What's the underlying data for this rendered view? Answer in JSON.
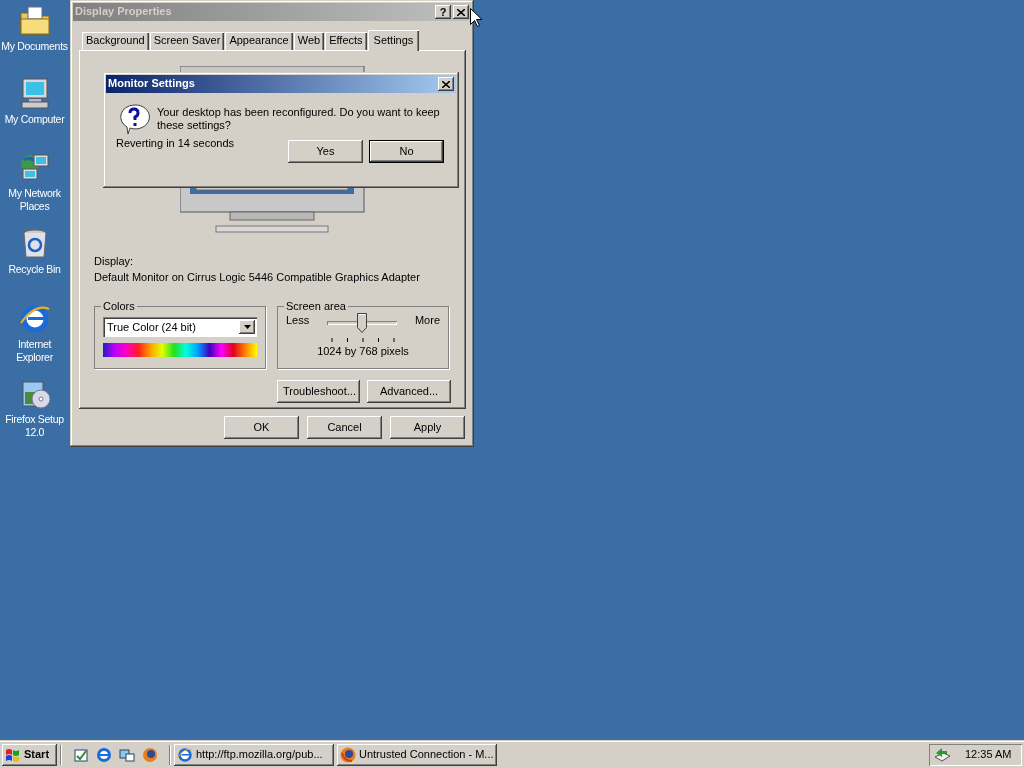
{
  "desktop_icons": [
    {
      "label": "My Documents",
      "kind": "folder"
    },
    {
      "label": "My Computer",
      "kind": "computer"
    },
    {
      "label": "My Network Places",
      "kind": "network"
    },
    {
      "label": "Recycle Bin",
      "kind": "bin"
    },
    {
      "label": "Internet Explorer",
      "kind": "browser"
    },
    {
      "label": "Firefox Setup 12.0",
      "kind": "installer"
    }
  ],
  "display_properties": {
    "title": "Display Properties",
    "active": false,
    "help_button": "?",
    "tabs": [
      {
        "label": "Background",
        "selected": false
      },
      {
        "label": "Screen Saver",
        "selected": false
      },
      {
        "label": "Appearance",
        "selected": false
      },
      {
        "label": "Web",
        "selected": false
      },
      {
        "label": "Effects",
        "selected": false
      },
      {
        "label": "Settings",
        "selected": true
      }
    ],
    "display_label": "Display:",
    "display_value": "Default Monitor on Cirrus Logic 5446 Compatible Graphics Adapter",
    "colors": {
      "legend": "Colors",
      "value": "True Color (24 bit)"
    },
    "screen_area": {
      "legend": "Screen area",
      "less": "Less",
      "more": "More",
      "level": 0.5,
      "reading": "1024 by 768 pixels"
    },
    "panel_buttons": [
      "Troubleshoot...",
      "Advanced..."
    ],
    "buttons": [
      {
        "label": "OK",
        "default": false
      },
      {
        "label": "Cancel",
        "default": false
      },
      {
        "label": "Apply",
        "default": false
      }
    ]
  },
  "monitor_settings": {
    "title": "Monitor Settings",
    "active": true,
    "message": "Your desktop has been reconfigured.  Do you want to keep these settings?",
    "countdown": "Reverting in 14 seconds",
    "buttons": [
      {
        "label": "Yes",
        "default": false
      },
      {
        "label": "No",
        "default": true
      }
    ]
  },
  "taskbar": {
    "start": "Start",
    "tasks": [
      {
        "label": "http://ftp.mozilla.org/pub...",
        "kind": "browser",
        "selected": false
      },
      {
        "label": "Untrusted Connection - M...",
        "kind": "firefox",
        "selected": false
      }
    ],
    "clock": "12:35 AM"
  }
}
